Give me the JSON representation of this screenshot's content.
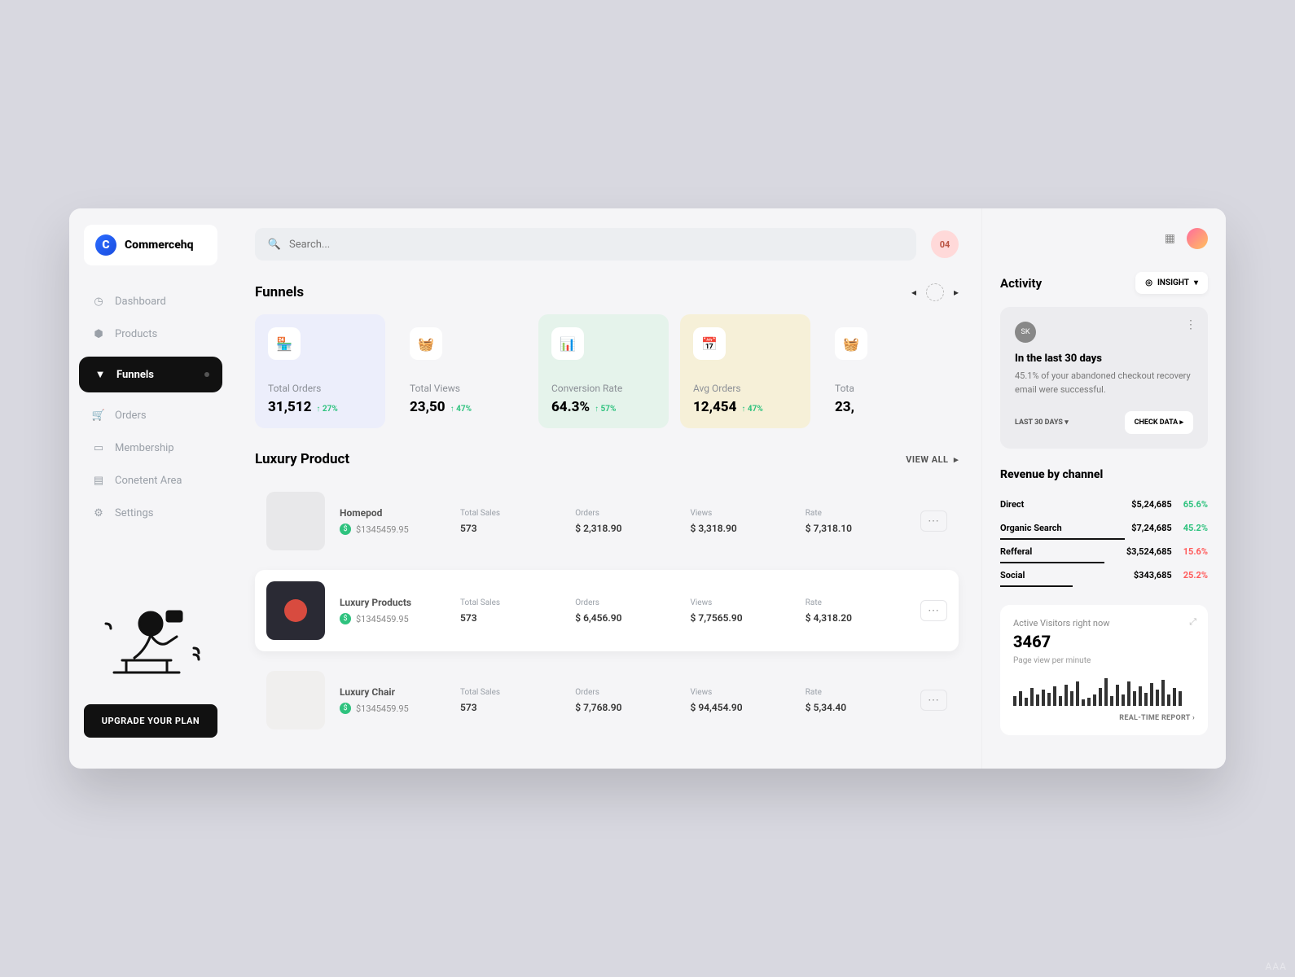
{
  "brand": "Commercehq",
  "search_placeholder": "Search...",
  "notification_count": "04",
  "sidebar": {
    "items": [
      {
        "label": "Dashboard",
        "icon": "◷"
      },
      {
        "label": "Products",
        "icon": "⬢"
      },
      {
        "label": "Funnels",
        "icon": "▼",
        "active": true
      },
      {
        "label": "Orders",
        "icon": "🛒"
      },
      {
        "label": "Membership",
        "icon": "▭"
      },
      {
        "label": "Conetent Area",
        "icon": "▤"
      },
      {
        "label": "Settings",
        "icon": "⚙"
      }
    ],
    "upgrade_label": "UPGRADE YOUR PLAN"
  },
  "funnels": {
    "title": "Funnels",
    "cards": [
      {
        "label": "Total Orders",
        "value": "31,512",
        "delta": "↑ 27%",
        "icon": "🏪"
      },
      {
        "label": "Total Views",
        "value": "23,50",
        "delta": "↑ 47%",
        "icon": "🧺"
      },
      {
        "label": "Conversion Rate",
        "value": "64.3%",
        "delta": "↑ 57%",
        "icon": "📊"
      },
      {
        "label": "Avg Orders",
        "value": "12,454",
        "delta": "↑ 47%",
        "icon": "📅"
      },
      {
        "label": "Tota",
        "value": "23,",
        "delta": "",
        "icon": "🧺"
      }
    ]
  },
  "luxury": {
    "title": "Luxury Product",
    "view_all": "VIEW ALL",
    "columns": [
      "Total Sales",
      "Orders",
      "Views",
      "Rate"
    ],
    "rows": [
      {
        "name": "Homepod",
        "price": "$1345459.95",
        "total_sales": "573",
        "orders": "$ 2,318.90",
        "views": "$ 3,318.90",
        "rate": "$ 7,318.10",
        "active": false,
        "img": "#e8e8ea"
      },
      {
        "name": "Luxury Products",
        "price": "$1345459.95",
        "total_sales": "573",
        "orders": "$ 6,456.90",
        "views": "$ 7,7565.90",
        "rate": "$ 4,318.20",
        "active": true,
        "img": "#2a2a34"
      },
      {
        "name": "Luxury Chair",
        "price": "$1345459.95",
        "total_sales": "573",
        "orders": "$ 7,768.90",
        "views": "$ 94,454.90",
        "rate": "$ 5,34.40",
        "active": false,
        "img": "#f0efee"
      }
    ]
  },
  "activity": {
    "title": "Activity",
    "insight_label": "INSIGHT",
    "avatar_initials": "SK",
    "headline": "In the last 30 days",
    "body": "45.1% of your abandoned checkout recovery email were successful.",
    "period_label": "LAST 30 DAYS",
    "check_label": "CHECK DATA"
  },
  "revenue": {
    "title": "Revenue by channel",
    "rows": [
      {
        "channel": "Direct",
        "amount": "$5,24,685",
        "pct": "65.6%",
        "tone": "green"
      },
      {
        "channel": "Organic Search",
        "amount": "$7,24,685",
        "pct": "45.2%",
        "tone": "green"
      },
      {
        "channel": "Refferal",
        "amount": "$3,524,685",
        "pct": "15.6%",
        "tone": "red"
      },
      {
        "channel": "Social",
        "amount": "$343,685",
        "pct": "25.2%",
        "tone": "red"
      }
    ]
  },
  "visitors": {
    "label": "Active Visitors right now",
    "value": "3467",
    "sub": "Page view per minute",
    "report_label": "REAL-TIME REPORT",
    "spark": [
      12,
      18,
      10,
      22,
      14,
      20,
      16,
      24,
      12,
      26,
      18,
      30,
      8,
      10,
      14,
      22,
      34,
      12,
      26,
      14,
      30,
      18,
      24,
      16,
      28,
      20,
      32,
      14,
      22,
      18
    ]
  },
  "watermark": "AAA"
}
